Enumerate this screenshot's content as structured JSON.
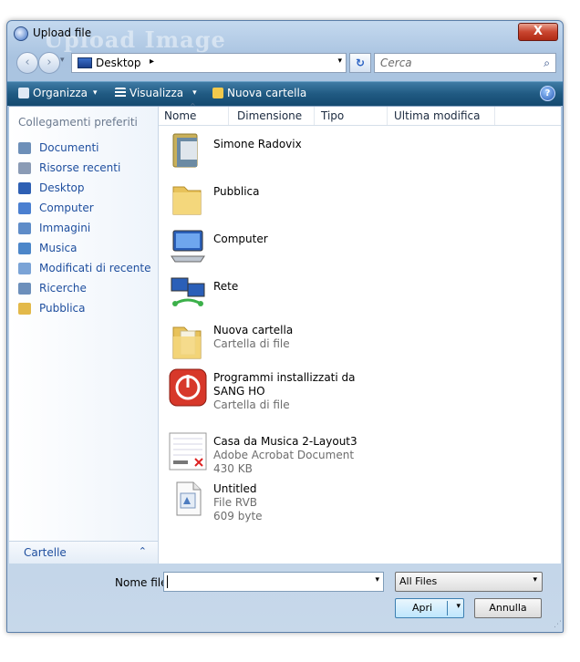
{
  "window": {
    "title": "Upload file",
    "background_title": "Upload Image",
    "close_label": "X"
  },
  "nav": {
    "back_glyph": "‹",
    "forward_glyph": "›",
    "history_glyph": "▾",
    "address": "Desktop",
    "address_arrow": "▸",
    "dropdown_glyph": "▾",
    "refresh_glyph": "↻",
    "search_placeholder": "Cerca",
    "search_glyph": "⌕"
  },
  "toolbar": {
    "organize": "Organizza",
    "view": "Visualizza",
    "new_folder": "Nuova cartella",
    "dropdown_glyph": "▾",
    "help_glyph": "?"
  },
  "sidebar": {
    "header": "Collegamenti preferiti",
    "items": [
      {
        "label": "Documenti",
        "icon": "documents-icon",
        "color": "#6d8fb8"
      },
      {
        "label": "Risorse recenti",
        "icon": "recent-icon",
        "color": "#8a9bb5"
      },
      {
        "label": "Desktop",
        "icon": "desktop-icon",
        "color": "#2d5fb3"
      },
      {
        "label": "Computer",
        "icon": "computer-icon",
        "color": "#4a7fd0"
      },
      {
        "label": "Immagini",
        "icon": "pictures-icon",
        "color": "#5e8cc8"
      },
      {
        "label": "Musica",
        "icon": "music-icon",
        "color": "#4c86c9"
      },
      {
        "label": "Modificati di recente",
        "icon": "recently-changed-icon",
        "color": "#7aa3d6"
      },
      {
        "label": "Ricerche",
        "icon": "searches-icon",
        "color": "#6c8fbb"
      },
      {
        "label": "Pubblica",
        "icon": "public-icon",
        "color": "#e3b94a"
      }
    ],
    "folders_label": "Cartelle",
    "folders_chevron": "⌃"
  },
  "columns": [
    "Nome",
    "Dimensione",
    "Tipo",
    "Ultima modifica"
  ],
  "sort_glyph": "^",
  "files": [
    {
      "name": "Simone Radovix",
      "sub": "",
      "icon": "user-folder-icon"
    },
    {
      "name": "Pubblica",
      "sub": "",
      "icon": "folder-icon"
    },
    {
      "name": "Computer",
      "sub": "",
      "icon": "computer-icon"
    },
    {
      "name": "Rete",
      "sub": "",
      "icon": "network-icon"
    },
    {
      "name": "Nuova cartella",
      "sub": "Cartella di file",
      "icon": "folder-icon"
    },
    {
      "name": "Programmi installizzati da SANG HO",
      "sub": "Cartella di file",
      "icon": "power-icon"
    },
    {
      "name": "Casa da Musica 2-Layout3",
      "sub": "Adobe Acrobat Document",
      "sub2": "430 KB",
      "icon": "pdf-icon"
    },
    {
      "name": "Untitled",
      "sub": "File RVB",
      "sub2": "609 byte",
      "icon": "rvb-file-icon"
    }
  ],
  "bottom": {
    "filename_label": "Nome file:",
    "filename_value": "",
    "dropdown_glyph": "▾",
    "filetype": "All Files",
    "open_label": "Apri",
    "cancel_label": "Annulla",
    "grip_glyph": "⋰"
  }
}
